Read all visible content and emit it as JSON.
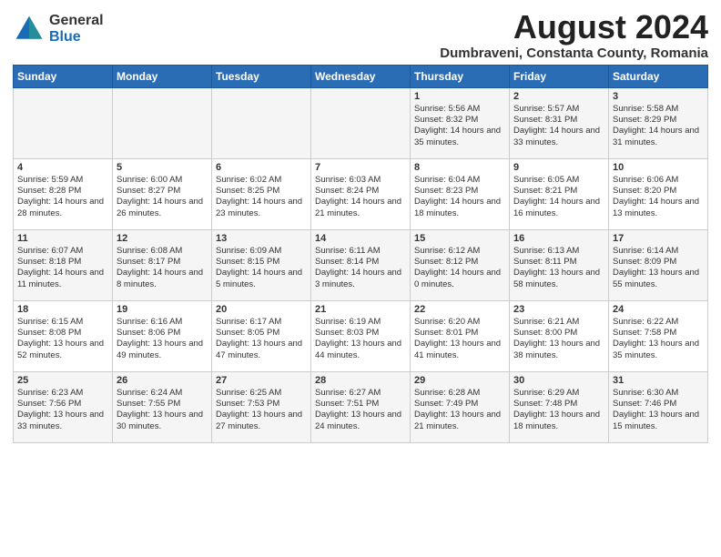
{
  "header": {
    "logo_general": "General",
    "logo_blue": "Blue",
    "month_year": "August 2024",
    "location": "Dumbraveni, Constanta County, Romania"
  },
  "weekdays": [
    "Sunday",
    "Monday",
    "Tuesday",
    "Wednesday",
    "Thursday",
    "Friday",
    "Saturday"
  ],
  "weeks": [
    [
      {
        "day": "",
        "text": ""
      },
      {
        "day": "",
        "text": ""
      },
      {
        "day": "",
        "text": ""
      },
      {
        "day": "",
        "text": ""
      },
      {
        "day": "1",
        "text": "Sunrise: 5:56 AM\nSunset: 8:32 PM\nDaylight: 14 hours and 35 minutes."
      },
      {
        "day": "2",
        "text": "Sunrise: 5:57 AM\nSunset: 8:31 PM\nDaylight: 14 hours and 33 minutes."
      },
      {
        "day": "3",
        "text": "Sunrise: 5:58 AM\nSunset: 8:29 PM\nDaylight: 14 hours and 31 minutes."
      }
    ],
    [
      {
        "day": "4",
        "text": "Sunrise: 5:59 AM\nSunset: 8:28 PM\nDaylight: 14 hours and 28 minutes."
      },
      {
        "day": "5",
        "text": "Sunrise: 6:00 AM\nSunset: 8:27 PM\nDaylight: 14 hours and 26 minutes."
      },
      {
        "day": "6",
        "text": "Sunrise: 6:02 AM\nSunset: 8:25 PM\nDaylight: 14 hours and 23 minutes."
      },
      {
        "day": "7",
        "text": "Sunrise: 6:03 AM\nSunset: 8:24 PM\nDaylight: 14 hours and 21 minutes."
      },
      {
        "day": "8",
        "text": "Sunrise: 6:04 AM\nSunset: 8:23 PM\nDaylight: 14 hours and 18 minutes."
      },
      {
        "day": "9",
        "text": "Sunrise: 6:05 AM\nSunset: 8:21 PM\nDaylight: 14 hours and 16 minutes."
      },
      {
        "day": "10",
        "text": "Sunrise: 6:06 AM\nSunset: 8:20 PM\nDaylight: 14 hours and 13 minutes."
      }
    ],
    [
      {
        "day": "11",
        "text": "Sunrise: 6:07 AM\nSunset: 8:18 PM\nDaylight: 14 hours and 11 minutes."
      },
      {
        "day": "12",
        "text": "Sunrise: 6:08 AM\nSunset: 8:17 PM\nDaylight: 14 hours and 8 minutes."
      },
      {
        "day": "13",
        "text": "Sunrise: 6:09 AM\nSunset: 8:15 PM\nDaylight: 14 hours and 5 minutes."
      },
      {
        "day": "14",
        "text": "Sunrise: 6:11 AM\nSunset: 8:14 PM\nDaylight: 14 hours and 3 minutes."
      },
      {
        "day": "15",
        "text": "Sunrise: 6:12 AM\nSunset: 8:12 PM\nDaylight: 14 hours and 0 minutes."
      },
      {
        "day": "16",
        "text": "Sunrise: 6:13 AM\nSunset: 8:11 PM\nDaylight: 13 hours and 58 minutes."
      },
      {
        "day": "17",
        "text": "Sunrise: 6:14 AM\nSunset: 8:09 PM\nDaylight: 13 hours and 55 minutes."
      }
    ],
    [
      {
        "day": "18",
        "text": "Sunrise: 6:15 AM\nSunset: 8:08 PM\nDaylight: 13 hours and 52 minutes."
      },
      {
        "day": "19",
        "text": "Sunrise: 6:16 AM\nSunset: 8:06 PM\nDaylight: 13 hours and 49 minutes."
      },
      {
        "day": "20",
        "text": "Sunrise: 6:17 AM\nSunset: 8:05 PM\nDaylight: 13 hours and 47 minutes."
      },
      {
        "day": "21",
        "text": "Sunrise: 6:19 AM\nSunset: 8:03 PM\nDaylight: 13 hours and 44 minutes."
      },
      {
        "day": "22",
        "text": "Sunrise: 6:20 AM\nSunset: 8:01 PM\nDaylight: 13 hours and 41 minutes."
      },
      {
        "day": "23",
        "text": "Sunrise: 6:21 AM\nSunset: 8:00 PM\nDaylight: 13 hours and 38 minutes."
      },
      {
        "day": "24",
        "text": "Sunrise: 6:22 AM\nSunset: 7:58 PM\nDaylight: 13 hours and 35 minutes."
      }
    ],
    [
      {
        "day": "25",
        "text": "Sunrise: 6:23 AM\nSunset: 7:56 PM\nDaylight: 13 hours and 33 minutes."
      },
      {
        "day": "26",
        "text": "Sunrise: 6:24 AM\nSunset: 7:55 PM\nDaylight: 13 hours and 30 minutes."
      },
      {
        "day": "27",
        "text": "Sunrise: 6:25 AM\nSunset: 7:53 PM\nDaylight: 13 hours and 27 minutes."
      },
      {
        "day": "28",
        "text": "Sunrise: 6:27 AM\nSunset: 7:51 PM\nDaylight: 13 hours and 24 minutes."
      },
      {
        "day": "29",
        "text": "Sunrise: 6:28 AM\nSunset: 7:49 PM\nDaylight: 13 hours and 21 minutes."
      },
      {
        "day": "30",
        "text": "Sunrise: 6:29 AM\nSunset: 7:48 PM\nDaylight: 13 hours and 18 minutes."
      },
      {
        "day": "31",
        "text": "Sunrise: 6:30 AM\nSunset: 7:46 PM\nDaylight: 13 hours and 15 minutes."
      }
    ]
  ]
}
